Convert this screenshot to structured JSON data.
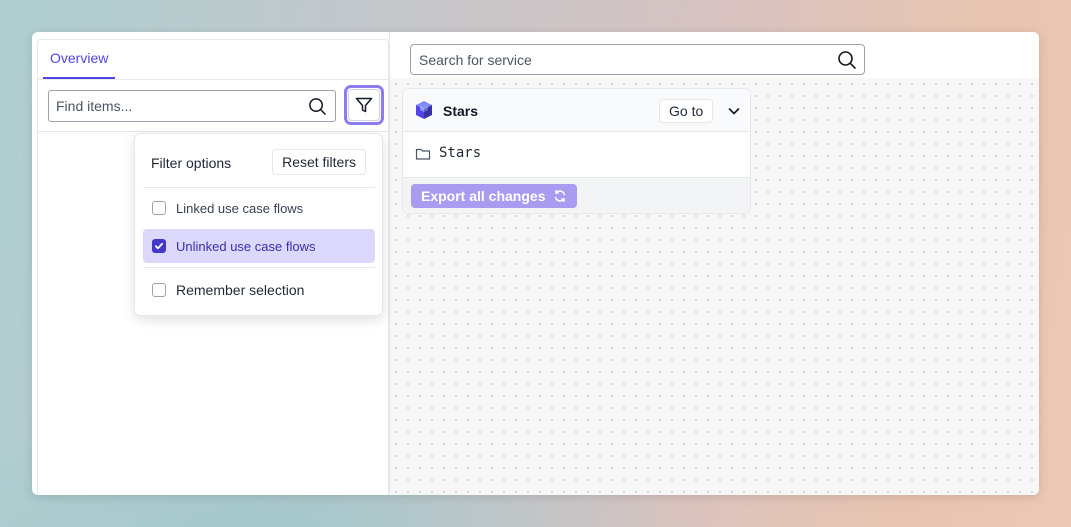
{
  "tabs": [
    {
      "label": "Overview",
      "active": true
    }
  ],
  "find": {
    "placeholder": "Find items...",
    "value": ""
  },
  "filter_dropdown": {
    "title": "Filter options",
    "reset_label": "Reset filters",
    "options": [
      {
        "label": "Linked use case flows",
        "checked": false
      },
      {
        "label": "Unlinked use case flows",
        "checked": true
      }
    ],
    "remember": {
      "label": "Remember selection",
      "checked": false
    }
  },
  "service_search": {
    "placeholder": "Search for service",
    "value": ""
  },
  "card": {
    "title": "Stars",
    "goto_label": "Go to",
    "rows": [
      {
        "label": "Stars",
        "icon": "folder-icon"
      }
    ],
    "export_label": "Export all changes"
  },
  "colors": {
    "accent": "#4f46e5",
    "selected_bg": "#dcd8fb",
    "export_bg": "#a89bf0",
    "focus_ring": "#8b7cf0"
  }
}
